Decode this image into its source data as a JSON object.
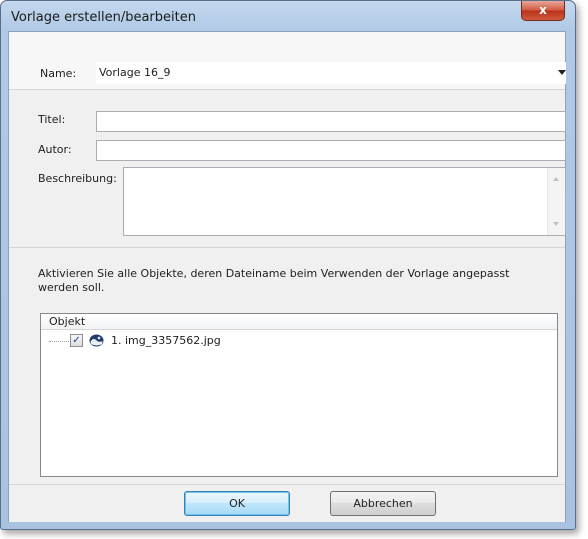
{
  "window": {
    "title": "Vorlage erstellen/bearbeiten",
    "close_glyph": "x"
  },
  "name_field": {
    "label": "Name:",
    "value": "Vorlage 16_9"
  },
  "title_field": {
    "label": "Titel:",
    "value": ""
  },
  "author_field": {
    "label": "Autor:",
    "value": ""
  },
  "description_field": {
    "label": "Beschreibung:",
    "value": ""
  },
  "objects": {
    "instruction_line1": "Aktivieren Sie alle Objekte, deren Dateiname beim Verwenden der Vorlage angepasst",
    "instruction_line2": "werden soll.",
    "column_header": "Objekt",
    "items": [
      {
        "label": "1. img_3357562.jpg",
        "checked": true,
        "check_glyph": "✓",
        "icon": "image-file-icon"
      }
    ]
  },
  "buttons": {
    "ok": "OK",
    "cancel": "Abbrechen"
  },
  "colors": {
    "frame": "#b0c9e6",
    "close_button": "#d0573f",
    "client_background": "#f0f0f0",
    "ok_button": "#bee6fd",
    "checkmark": "#1c3f95"
  }
}
